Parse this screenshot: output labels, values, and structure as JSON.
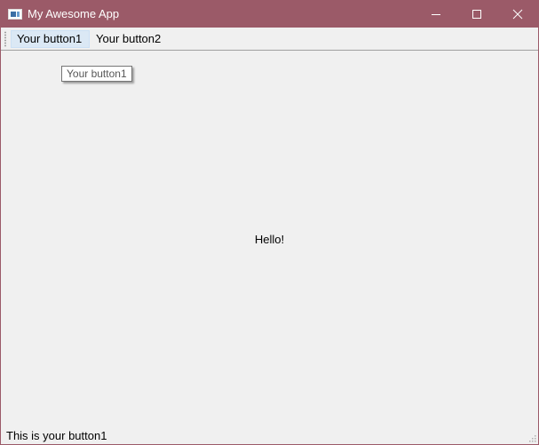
{
  "window": {
    "title": "My Awesome App",
    "accent_color": "#9b5a68",
    "icons": {
      "app": "app-window-icon",
      "minimize": "minimize-icon",
      "maximize": "maximize-icon",
      "close": "close-icon"
    }
  },
  "toolbar": {
    "button1_label": "Your button1",
    "button2_label": "Your button2",
    "active_button": "button1"
  },
  "tooltip": {
    "text": "Your button1"
  },
  "main": {
    "label": "Hello!"
  },
  "statusbar": {
    "message": "This is your button1"
  }
}
